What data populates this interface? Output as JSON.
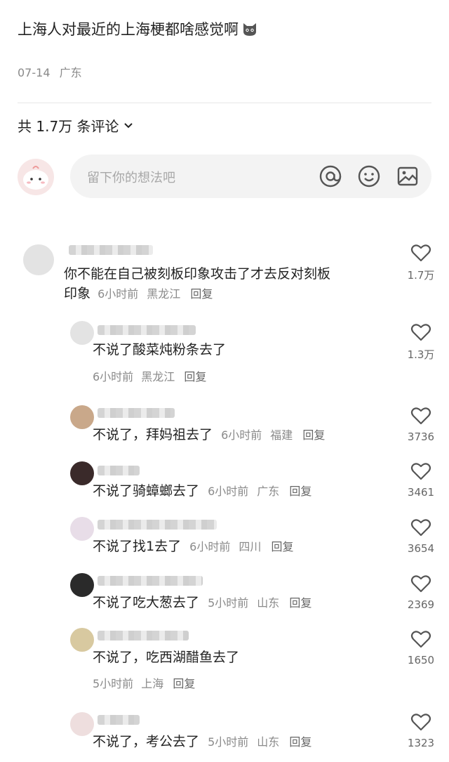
{
  "post": {
    "title": "上海人对最近的上海梗都啥感觉啊",
    "date": "07-14",
    "location": "广东"
  },
  "comments_header": {
    "count_label": "共 1.7万 条评论"
  },
  "input": {
    "placeholder": "留下你的想法吧"
  },
  "comments": [
    {
      "text_line1": "你不能在自己被刻板印象攻击了才去反对刻板",
      "text_line2": "印象",
      "time": "6小时前",
      "loc": "黑龙江",
      "reply": "回复",
      "likes": "1.7万"
    },
    {
      "text": "不说了酸菜炖粉条去了",
      "time": "6小时前",
      "loc": "黑龙江",
      "reply": "回复",
      "likes": "1.3万"
    },
    {
      "text": "不说了，拜妈祖去了",
      "time": "6小时前",
      "loc": "福建",
      "reply": "回复",
      "likes": "3736"
    },
    {
      "text": "不说了骑蟑螂去了",
      "time": "6小时前",
      "loc": "广东",
      "reply": "回复",
      "likes": "3461"
    },
    {
      "text": "不说了找1去了",
      "time": "6小时前",
      "loc": "四川",
      "reply": "回复",
      "likes": "3654"
    },
    {
      "text": "不说了吃大葱去了",
      "time": "5小时前",
      "loc": "山东",
      "reply": "回复",
      "likes": "2369"
    },
    {
      "text": "不说了，吃西湖醋鱼去了",
      "time": "5小时前",
      "loc": "上海",
      "reply": "回复",
      "likes": "1650"
    },
    {
      "text": "不说了，考公去了",
      "time": "5小时前",
      "loc": "山东",
      "reply": "回复",
      "likes": "1323"
    }
  ]
}
